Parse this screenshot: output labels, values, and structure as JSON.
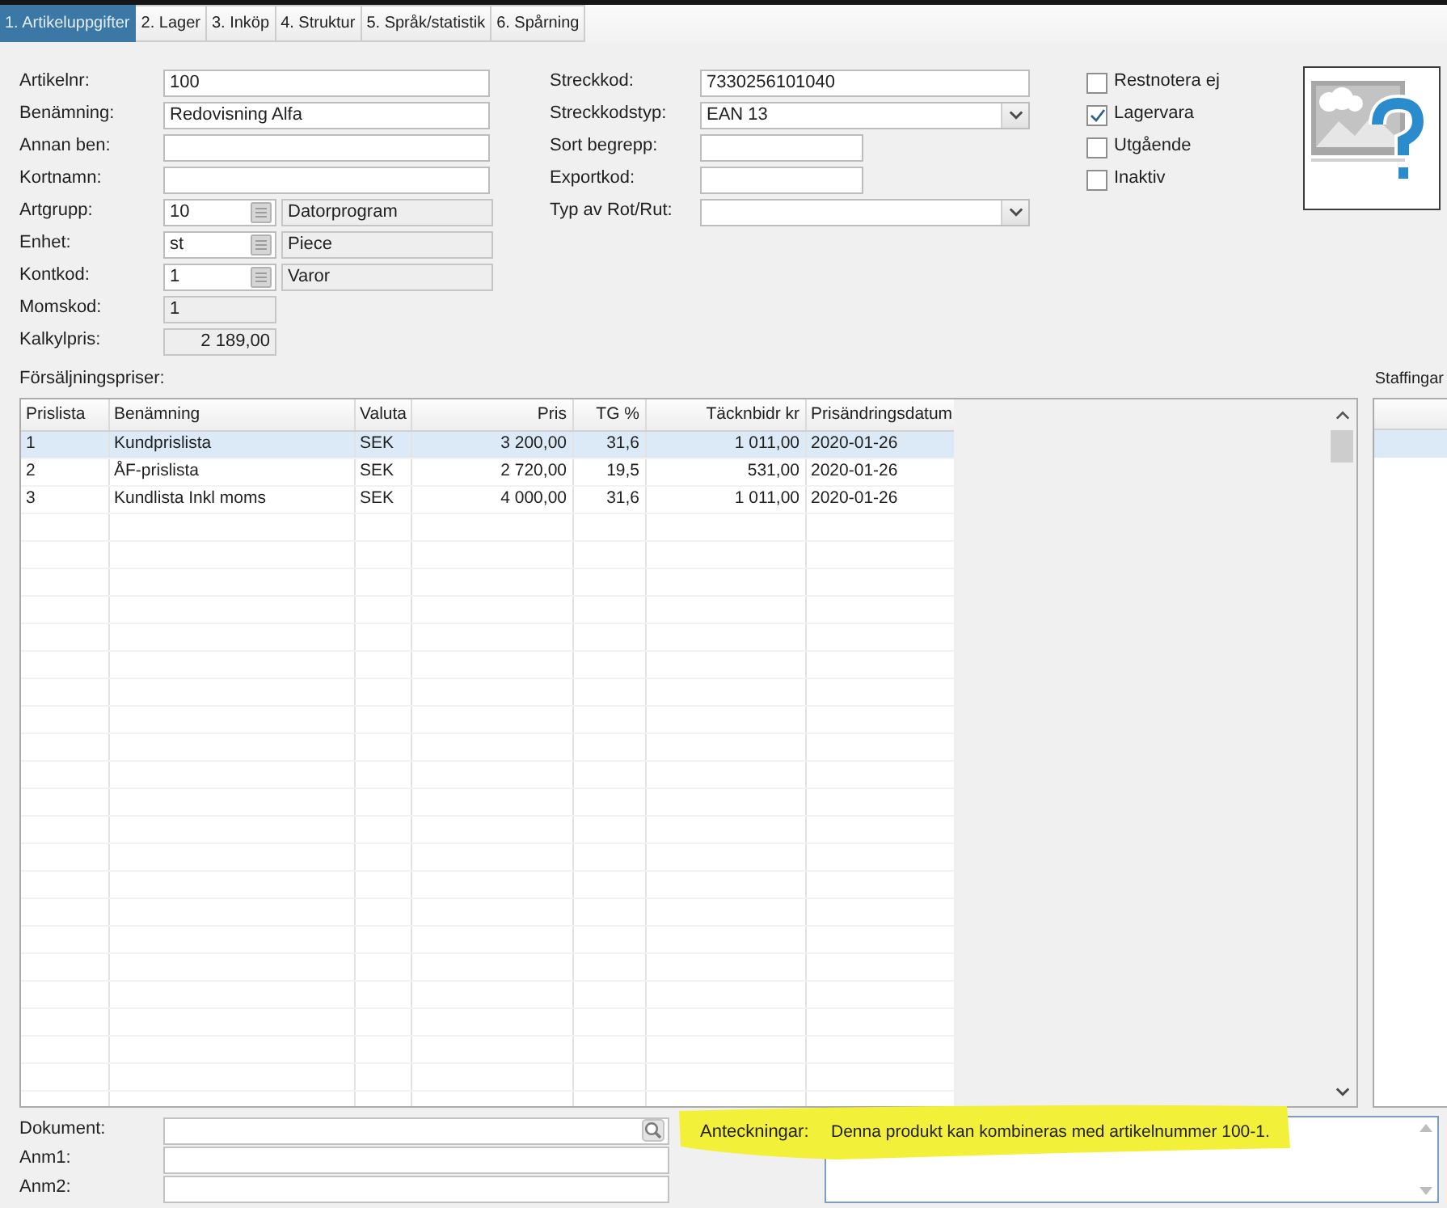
{
  "tabs": [
    {
      "label": "1. Artikeluppgifter",
      "selected": true
    },
    {
      "label": "2. Lager",
      "selected": false
    },
    {
      "label": "3. Inköp",
      "selected": false
    },
    {
      "label": "4. Struktur",
      "selected": false
    },
    {
      "label": "5. Språk/statistik",
      "selected": false
    },
    {
      "label": "6. Spårning",
      "selected": false
    }
  ],
  "article_fields": [
    {
      "label": "Artikelnr:",
      "kind": "text",
      "value": "100"
    },
    {
      "label": "Benämning:",
      "kind": "text",
      "value": "Redovisning Alfa"
    },
    {
      "label": "Annan ben:",
      "kind": "text"
    },
    {
      "label": "Kortnamn:",
      "kind": "text"
    },
    {
      "label": "Artgrupp:",
      "kind": "lookup",
      "value": "10",
      "description": "Datorprogram"
    },
    {
      "label": "Enhet:",
      "kind": "lookup",
      "value": "st",
      "description": "Piece"
    },
    {
      "label": "Kontkod:",
      "kind": "lookup",
      "value": "1",
      "description": "Varor"
    },
    {
      "label": "Momskod:",
      "kind": "readonly",
      "value": "1"
    },
    {
      "label": "Kalkylpris:",
      "kind": "amount",
      "value": "2 189,00"
    }
  ],
  "code_fields": [
    {
      "label": "Streckkod:",
      "kind": "text",
      "value": "7330256101040"
    },
    {
      "label": "Streckkodstyp:",
      "kind": "dropdown",
      "value": "EAN 13"
    },
    {
      "label": "Sort begrepp:",
      "kind": "short"
    },
    {
      "label": "Exportkod:",
      "kind": "short"
    },
    {
      "label": "Typ av Rot/Rut:",
      "kind": "dropdown"
    }
  ],
  "flags": [
    {
      "label": "Restnotera ej",
      "checked": false
    },
    {
      "label": "Lagervara",
      "checked": true
    },
    {
      "label": "Utgående",
      "checked": false
    },
    {
      "label": "Inaktiv",
      "checked": false
    }
  ],
  "price_lists": {
    "title": "Försäljningspriser:",
    "columns": [
      {
        "label": "Prislista",
        "kind": "text"
      },
      {
        "label": "Benämning",
        "kind": "text"
      },
      {
        "label": "Valuta",
        "kind": "text"
      },
      {
        "label": "Pris",
        "kind": "number"
      },
      {
        "label": "TG %",
        "kind": "number"
      },
      {
        "label": "Täcknbidr kr",
        "kind": "number"
      },
      {
        "label": "Prisändringsdatum",
        "kind": "text"
      }
    ],
    "rows": [
      {
        "cells": [
          "1",
          "Kundprislista",
          "SEK",
          "3 200,00",
          "31,6",
          "1 011,00",
          "2020-01-26"
        ],
        "selected": true
      },
      {
        "cells": [
          "2",
          "ÅF-prislista",
          "SEK",
          "2 720,00",
          "19,5",
          "531,00",
          "2020-01-26"
        ],
        "selected": false
      },
      {
        "cells": [
          "3",
          "Kundlista Inkl moms",
          "SEK",
          "4 000,00",
          "31,6",
          "1 011,00",
          "2020-01-26"
        ],
        "selected": false
      }
    ]
  },
  "graduations": {
    "title": "Staffingar",
    "rows": [
      {
        "selected": true
      }
    ]
  },
  "attachments": [
    {
      "label": "Dokument:",
      "kind": "file"
    },
    {
      "label": "Anm1:",
      "kind": "text"
    },
    {
      "label": "Anm2:",
      "kind": "text"
    }
  ],
  "notes": {
    "label": "Anteckningar:",
    "value": "Denna produkt kan kombineras med artikelnummer 100-1.",
    "highlighted": true
  }
}
